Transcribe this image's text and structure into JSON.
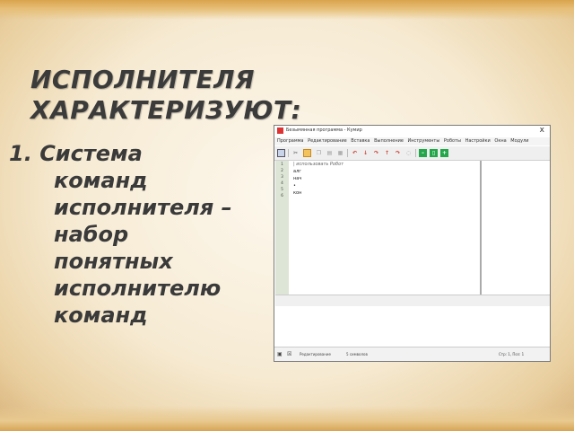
{
  "slide": {
    "title_line1": "ИСПОЛНИТЕЛЯ",
    "title_line2": "ХАРАКТЕРИЗУЮТ:",
    "item_number": "1.",
    "item_lines": [
      "Система",
      "команд",
      "исполнителя –",
      "набор",
      "понятных",
      "исполнителю",
      "команд"
    ]
  },
  "app": {
    "window_title": "Безымянная программа - Кумир",
    "close_label": "x",
    "menu": [
      "Программа",
      "Редактирование",
      "Вставка",
      "Выполнение",
      "Инструменты",
      "Роботы",
      "Настройки",
      "Окна",
      "Модули"
    ],
    "toolbar_icons": [
      "save-icon",
      "cut-icon",
      "copy-icon",
      "paste-icon",
      "undo-icon",
      "redo-icon",
      "run-icon",
      "step-icon",
      "stop-icon"
    ],
    "line_numbers": [
      "1",
      "2",
      "3",
      "4",
      "5",
      "6"
    ],
    "code_lines": [
      "| использовать Робот",
      "алг",
      "нач",
      "•",
      "кон",
      ""
    ],
    "status": {
      "mode": "Редактирование",
      "lines": "5 символов",
      "position": "Стр: 1, Поз: 1"
    }
  }
}
